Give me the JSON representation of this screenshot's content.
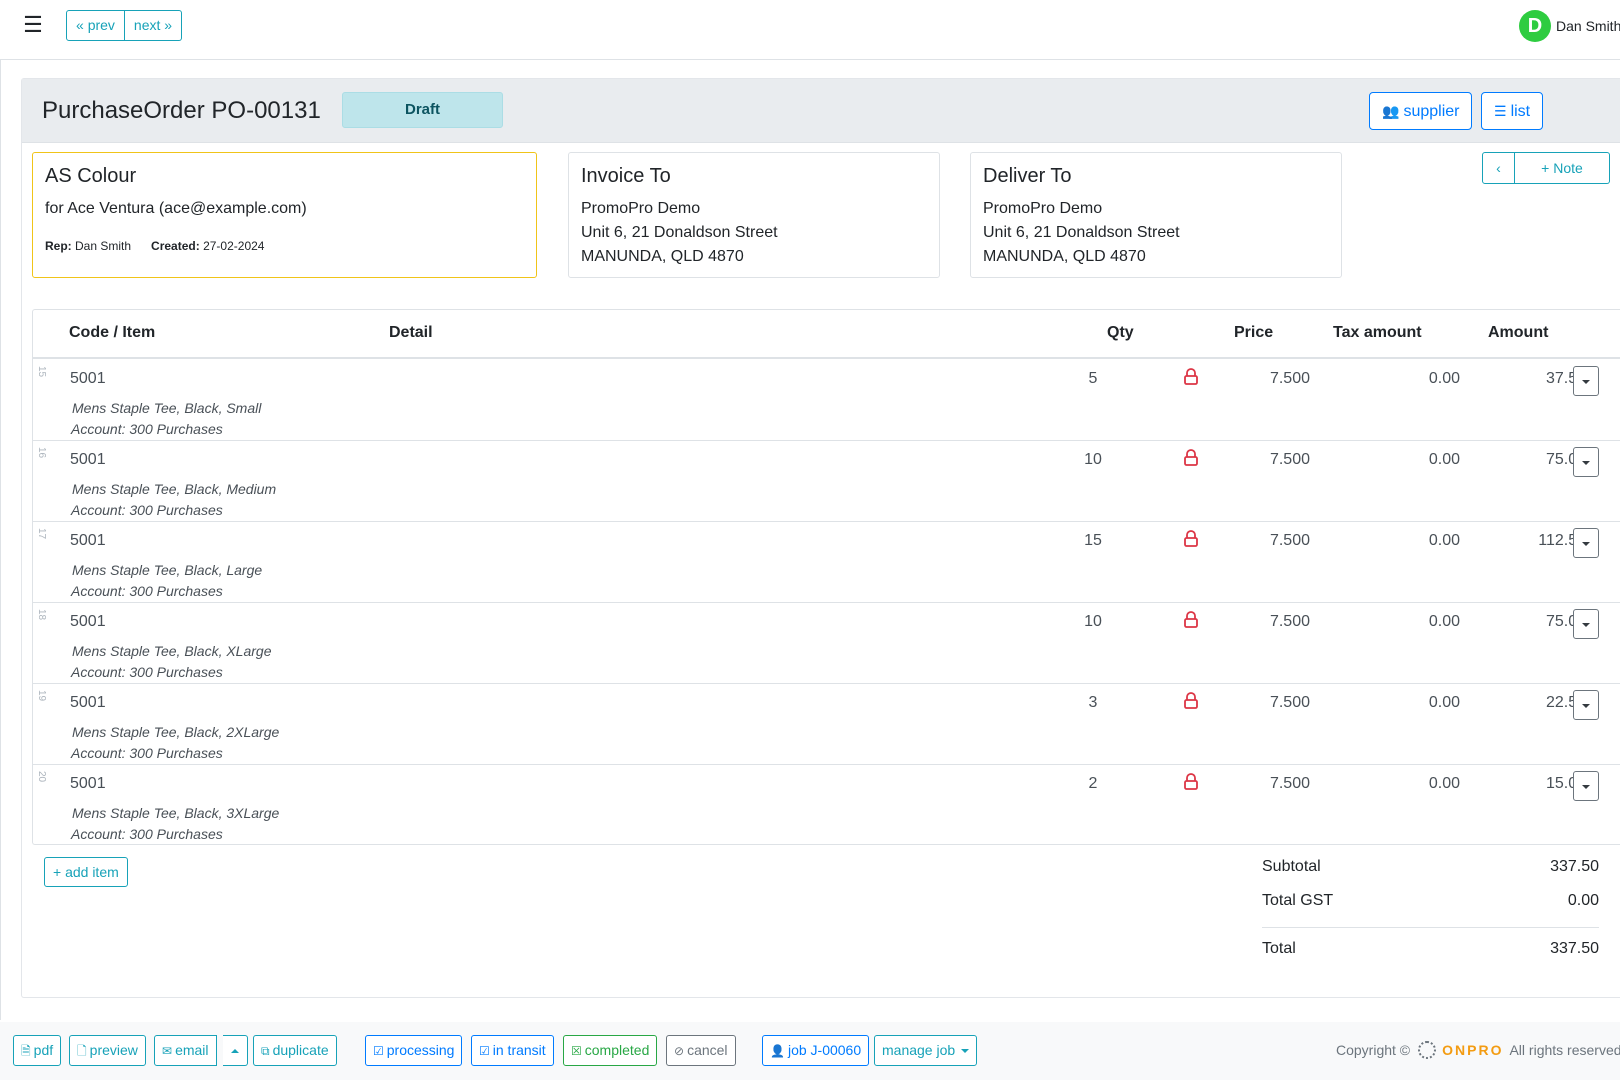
{
  "topbar": {
    "prev_label": "prev",
    "next_label": "next",
    "user_initial": "D",
    "user_name": "Dan Smith",
    "avatar_color": "#2ecc40"
  },
  "header": {
    "title": "PurchaseOrder PO-00131",
    "status": "Draft",
    "supplier_label": "supplier",
    "list_label": "list"
  },
  "supplier_box": {
    "name": "AS Colour",
    "for_line": "for Ace Ventura (ace@example.com)",
    "rep_label": "Rep:",
    "rep_value": "Dan Smith",
    "created_label": "Created:",
    "created_value": "27-02-2024"
  },
  "invoice_to": {
    "heading": "Invoice To",
    "lines": [
      "PromoPro Demo",
      "Unit 6, 21 Donaldson Street",
      "MANUNDA, QLD 4870"
    ]
  },
  "deliver_to": {
    "heading": "Deliver To",
    "lines": [
      "PromoPro Demo",
      "Unit 6, 21 Donaldson Street",
      "MANUNDA, QLD 4870"
    ]
  },
  "note_button": "Note",
  "table": {
    "headers": {
      "code": "Code / Item",
      "detail": "Detail",
      "qty": "Qty",
      "price": "Price",
      "tax": "Tax amount",
      "amount": "Amount"
    },
    "rows": [
      {
        "num": "15",
        "code": "5001",
        "desc": "Mens Staple Tee, Black, Small",
        "account": "Account: 300 Purchases",
        "qty": "5",
        "price": "7.500",
        "tax": "0.00",
        "amount": "37.50"
      },
      {
        "num": "16",
        "code": "5001",
        "desc": "Mens Staple Tee, Black, Medium",
        "account": "Account: 300 Purchases",
        "qty": "10",
        "price": "7.500",
        "tax": "0.00",
        "amount": "75.00"
      },
      {
        "num": "17",
        "code": "5001",
        "desc": "Mens Staple Tee, Black, Large",
        "account": "Account: 300 Purchases",
        "qty": "15",
        "price": "7.500",
        "tax": "0.00",
        "amount": "112.50"
      },
      {
        "num": "18",
        "code": "5001",
        "desc": "Mens Staple Tee, Black, XLarge",
        "account": "Account: 300 Purchases",
        "qty": "10",
        "price": "7.500",
        "tax": "0.00",
        "amount": "75.00"
      },
      {
        "num": "19",
        "code": "5001",
        "desc": "Mens Staple Tee, Black, 2XLarge",
        "account": "Account: 300 Purchases",
        "qty": "3",
        "price": "7.500",
        "tax": "0.00",
        "amount": "22.50"
      },
      {
        "num": "20",
        "code": "5001",
        "desc": "Mens Staple Tee, Black, 3XLarge",
        "account": "Account: 300 Purchases",
        "qty": "2",
        "price": "7.500",
        "tax": "0.00",
        "amount": "15.00"
      }
    ]
  },
  "add_item_label": "add item",
  "totals": {
    "subtotal_label": "Subtotal",
    "subtotal_value": "337.50",
    "gst_label": "Total GST",
    "gst_value": "0.00",
    "total_label": "Total",
    "total_value": "337.50"
  },
  "footer": {
    "pdf": "pdf",
    "preview": "preview",
    "email": "email",
    "duplicate": "duplicate",
    "processing": "processing",
    "in_transit": "in transit",
    "completed": "completed",
    "cancel": "cancel",
    "job": "job J-00060",
    "manage_job": "manage job",
    "copyright": "Copyright ©",
    "brand": "ONPRO",
    "rights": "All rights reserved"
  },
  "colors": {
    "info": "#17a2b8",
    "primary": "#007bff",
    "success": "#28a745",
    "secondary": "#6c757d",
    "danger": "#dc3545",
    "supplier_border": "#f0c419"
  },
  "icons": [
    "hamburger-icon",
    "chevrons-left-icon",
    "chevrons-right-icon",
    "users-icon",
    "list-icon",
    "chevron-left-icon",
    "plus-icon",
    "lock-icon",
    "caret-down-icon",
    "file-pdf-icon",
    "file-icon",
    "envelope-icon",
    "caret-up-icon",
    "copy-icon",
    "check-square-icon",
    "x-square-icon",
    "ban-icon",
    "user-tie-icon",
    "onpro-logo"
  ]
}
